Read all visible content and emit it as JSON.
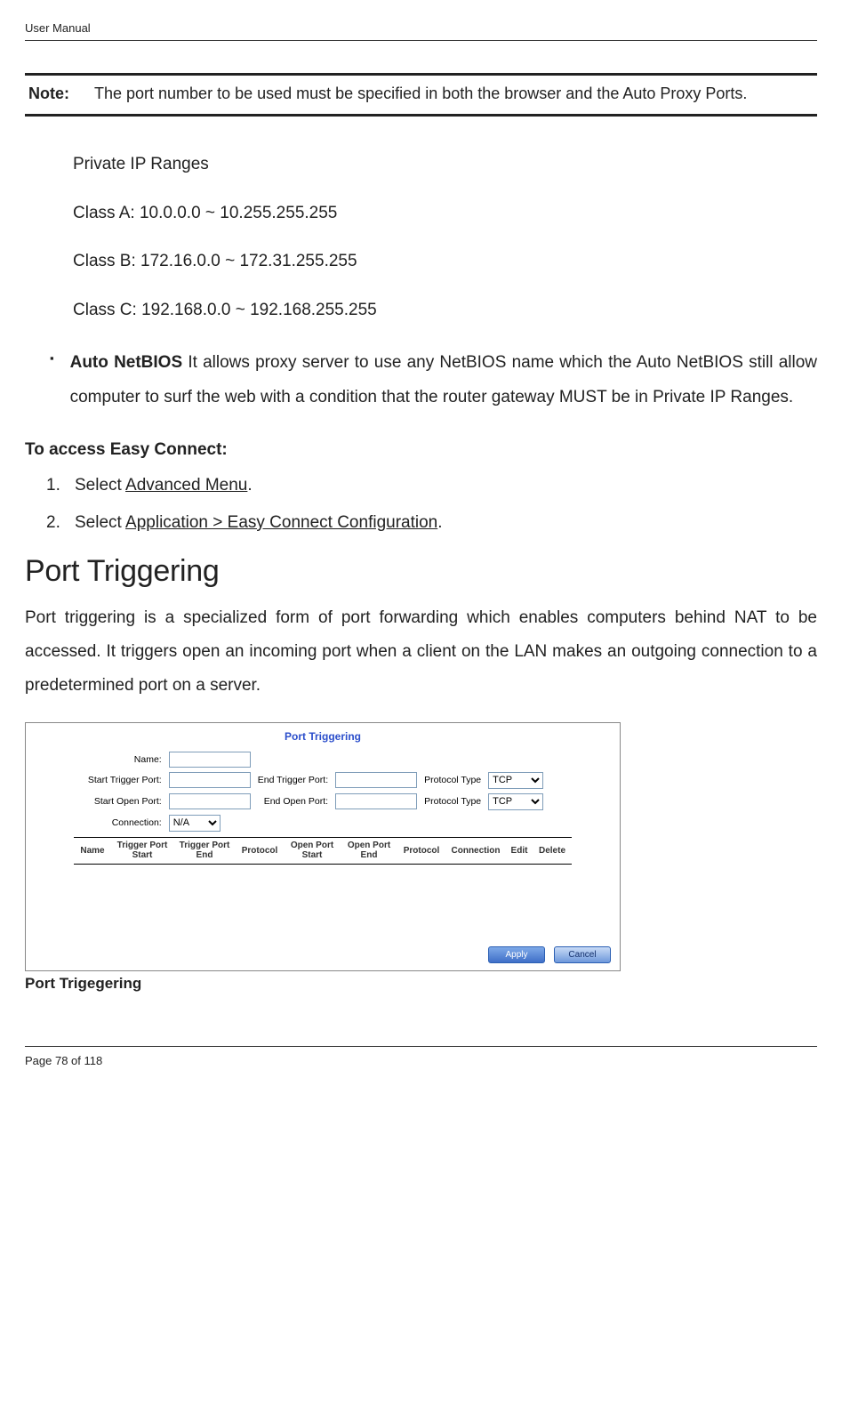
{
  "header": {
    "title": "User Manual"
  },
  "note": {
    "label": "Note:",
    "text": "The port number to be used must be specified in both the browser and the Auto Proxy Ports."
  },
  "private_ip": {
    "heading": "Private IP Ranges",
    "class_a": "Class A: 10.0.0.0 ~ 10.255.255.255",
    "class_b": "Class B: 172.16.0.0 ~ 172.31.255.255",
    "class_c": "Class C: 192.168.0.0 ~ 192.168.255.255"
  },
  "auto_netbios": {
    "term": "Auto NetBIOS",
    "desc": " It allows proxy server to use any NetBIOS name which the Auto NetBIOS still allow computer to surf the web with a condition that the router gateway MUST be in Private IP Ranges."
  },
  "access": {
    "heading": "To access Easy Connect:",
    "step1_prefix": "1.",
    "step1_text": "Select ",
    "step1_link": "Advanced Menu",
    "step1_suffix": ".",
    "step2_prefix": "2.",
    "step2_text": "Select ",
    "step2_link": "Application > Easy Connect Configuration",
    "step2_suffix": "."
  },
  "port_triggering": {
    "title": "Port Triggering",
    "body": "Port triggering is a specialized form of port forwarding which enables computers behind NAT to be accessed. It triggers open an incoming port when a client on the LAN makes an outgoing connection to a predetermined port on a server."
  },
  "pt_panel": {
    "title": "Port Triggering",
    "labels": {
      "name": "Name:",
      "start_trigger": "Start Trigger Port:",
      "end_trigger": "End Trigger Port:",
      "protocol_type": "Protocol Type",
      "start_open": "Start Open Port:",
      "end_open": "End Open Port:",
      "connection": "Connection:"
    },
    "selects": {
      "protocol1": "TCP",
      "protocol2": "TCP",
      "connection": "N/A"
    },
    "table_headers": {
      "name": "Name",
      "trig_start": "Trigger Port Start",
      "trig_end": "Trigger Port End",
      "protocol": "Protocol",
      "open_start": "Open Port Start",
      "open_end": "Open Port End",
      "protocol2": "Protocol",
      "connection": "Connection",
      "edit": "Edit",
      "delete": "Delete"
    },
    "buttons": {
      "apply": "Apply",
      "cancel": "Cancel"
    }
  },
  "caption": "Port Trigegering",
  "footer": {
    "page_text": "Page 78 of 118"
  }
}
